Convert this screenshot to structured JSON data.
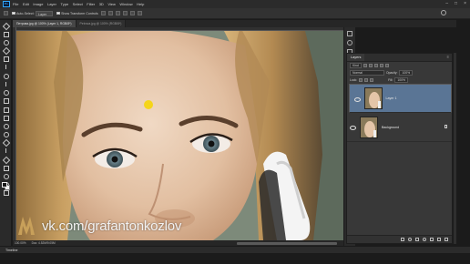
{
  "menu": [
    "File",
    "Edit",
    "Image",
    "Layer",
    "Type",
    "Select",
    "Filter",
    "3D",
    "View",
    "Window",
    "Help"
  ],
  "app_logo": "Ps",
  "options": {
    "auto_select_label": "Auto-Select:",
    "auto_select_value": "Layer",
    "transform_label": "Show Transform Controls"
  },
  "tabs": [
    {
      "label": "Петрова.jpg @ 100% (Layer 1, RGB/8*)",
      "active": true
    },
    {
      "label": "Petrova.jpg @ 100% (RGB/8*)",
      "active": false
    }
  ],
  "status": {
    "zoom": "100.00%",
    "doc": "Doc: 4.52M/9.05M"
  },
  "timeline_label": "Timeline",
  "layers_panel": {
    "tab_label": "Layers",
    "kind_label": "Kind",
    "blend_mode": "Normal",
    "opacity_label": "Opacity:",
    "opacity_value": "100%",
    "lock_label": "Lock:",
    "fill_label": "Fill:",
    "fill_value": "100%",
    "layers": [
      {
        "name": "Layer 1",
        "selected": true
      },
      {
        "name": "Background",
        "selected": false
      }
    ]
  },
  "watermark": "vk.com/grafantonkozlov",
  "colors": {
    "accent": "#31a8ff",
    "selection": "#5a7595",
    "ui_dark": "#2b2b2b"
  }
}
